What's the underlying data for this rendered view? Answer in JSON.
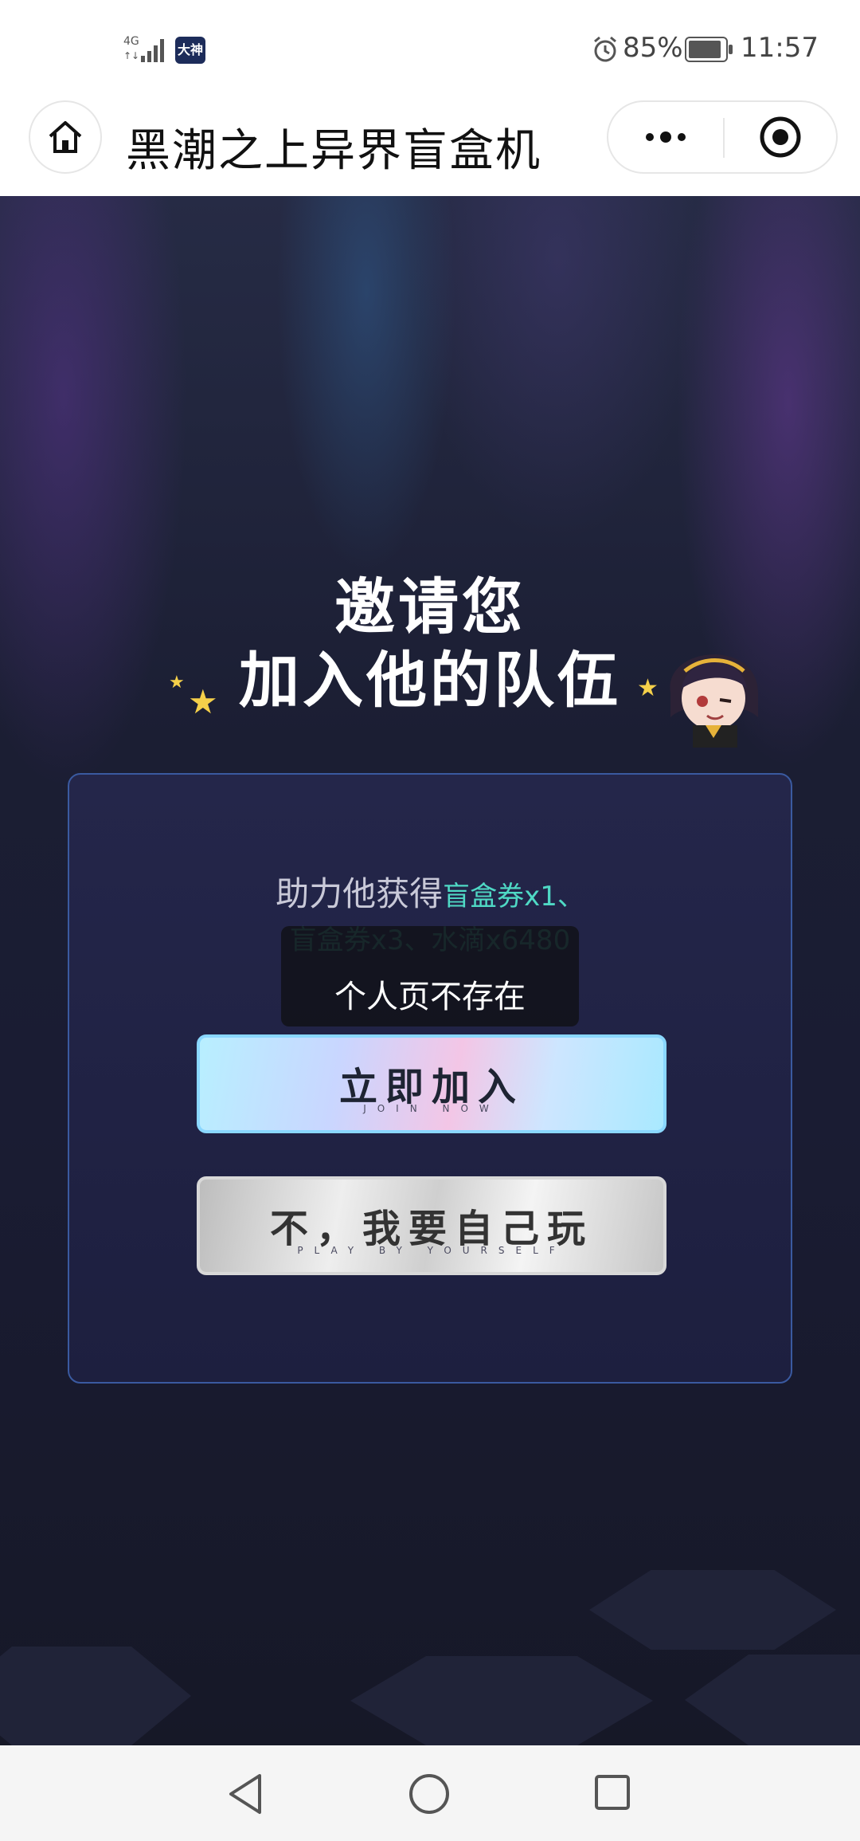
{
  "status_bar": {
    "network": "4G",
    "app_badge": "大神",
    "battery": "85%",
    "time": "11:57"
  },
  "nav": {
    "title": "黑潮之上异界盲盒机",
    "more_icon": "more-dots-icon",
    "close_icon": "target-close-icon",
    "home_icon": "home-icon"
  },
  "invite": {
    "title_line1": "邀请您",
    "title_line2": "加入他的队伍"
  },
  "card": {
    "help_prefix": "助力他获得",
    "reward_1": "盲盒券x1、",
    "reward_line2": "盲盒券x3、水滴x6480",
    "toast": "个人页不存在",
    "join_button": {
      "label": "立即加入",
      "sublabel": "JOIN NOW"
    },
    "decline_button": {
      "label": "不，我要自己玩",
      "sublabel": "PLAY BY YOURSELF"
    }
  },
  "system_nav": {
    "back_icon": "back-triangle-icon",
    "home_icon": "home-circle-icon",
    "recent_icon": "recent-square-icon"
  },
  "colors": {
    "accent_text": "#4fd9c5",
    "card_border": "#3a5aa0",
    "background": "#1b1e33"
  }
}
